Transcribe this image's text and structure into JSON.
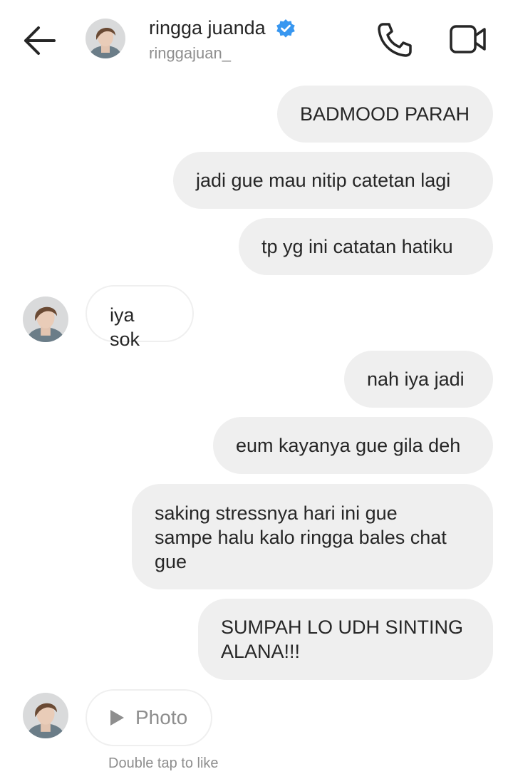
{
  "header": {
    "name": "ringga juanda",
    "username": "ringgajuan_",
    "verified": true,
    "icons": [
      "back-arrow-icon",
      "verified-badge-icon",
      "phone-call-icon",
      "video-call-icon"
    ]
  },
  "messages": [
    {
      "from": "me",
      "text": "BADMOOD PARAH"
    },
    {
      "from": "me",
      "text": "jadi gue mau nitip catetan lagi"
    },
    {
      "from": "me",
      "text": "tp yg ini catatan hatiku"
    },
    {
      "from": "them",
      "text": "iya sok"
    },
    {
      "from": "me",
      "text": "nah iya jadi"
    },
    {
      "from": "me",
      "text": "eum kayanya gue gila deh"
    },
    {
      "from": "me",
      "text": "saking stressnya hari ini gue\nsampe halu kalo ringga bales chat\ngue"
    },
    {
      "from": "me",
      "text": "SUMPAH LO UDH SINTING\nALANA!!!"
    },
    {
      "from": "them",
      "type": "photo",
      "text": "Photo"
    }
  ],
  "hint": "Double tap to like",
  "colors": {
    "bubble_out": "#efefef",
    "secondary_text": "#8e8e8e",
    "verified_blue": "#3897f0",
    "text": "#262626"
  }
}
